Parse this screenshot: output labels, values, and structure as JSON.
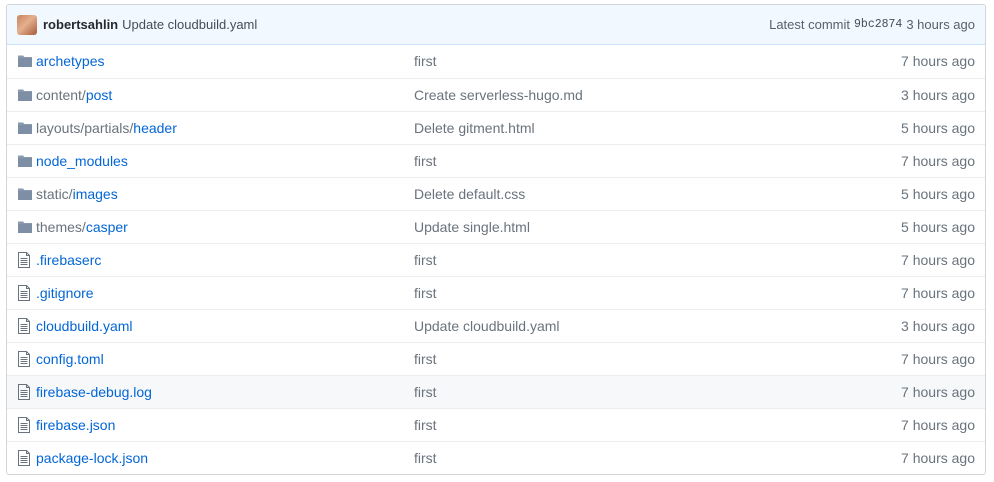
{
  "commit": {
    "author": "robertsahlin",
    "message": "Update cloudbuild.yaml",
    "latest_label": "Latest commit",
    "sha": "9bc2874",
    "age": "3 hours ago"
  },
  "files": [
    {
      "type": "dir",
      "prefix": "",
      "name": "archetypes",
      "message": "first",
      "age": "7 hours ago"
    },
    {
      "type": "dir",
      "prefix": "content/",
      "name": "post",
      "message": "Create serverless-hugo.md",
      "age": "3 hours ago"
    },
    {
      "type": "dir",
      "prefix": "layouts/partials/",
      "name": "header",
      "message": "Delete gitment.html",
      "age": "5 hours ago"
    },
    {
      "type": "dir",
      "prefix": "",
      "name": "node_modules",
      "message": "first",
      "age": "7 hours ago"
    },
    {
      "type": "dir",
      "prefix": "static/",
      "name": "images",
      "message": "Delete default.css",
      "age": "5 hours ago"
    },
    {
      "type": "dir",
      "prefix": "themes/",
      "name": "casper",
      "message": "Update single.html",
      "age": "5 hours ago"
    },
    {
      "type": "file",
      "prefix": "",
      "name": ".firebaserc",
      "message": "first",
      "age": "7 hours ago"
    },
    {
      "type": "file",
      "prefix": "",
      "name": ".gitignore",
      "message": "first",
      "age": "7 hours ago"
    },
    {
      "type": "file",
      "prefix": "",
      "name": "cloudbuild.yaml",
      "message": "Update cloudbuild.yaml",
      "age": "3 hours ago"
    },
    {
      "type": "file",
      "prefix": "",
      "name": "config.toml",
      "message": "first",
      "age": "7 hours ago"
    },
    {
      "type": "file",
      "prefix": "",
      "name": "firebase-debug.log",
      "message": "first",
      "age": "7 hours ago",
      "highlighted": true
    },
    {
      "type": "file",
      "prefix": "",
      "name": "firebase.json",
      "message": "first",
      "age": "7 hours ago"
    },
    {
      "type": "file",
      "prefix": "",
      "name": "package-lock.json",
      "message": "first",
      "age": "7 hours ago"
    }
  ],
  "colors": {
    "link": "#0366d6",
    "muted": "#6a737d",
    "folder_icon": "#79b8ff",
    "file_icon": "#6a737d",
    "commit_bar": "#f1f8ff"
  }
}
